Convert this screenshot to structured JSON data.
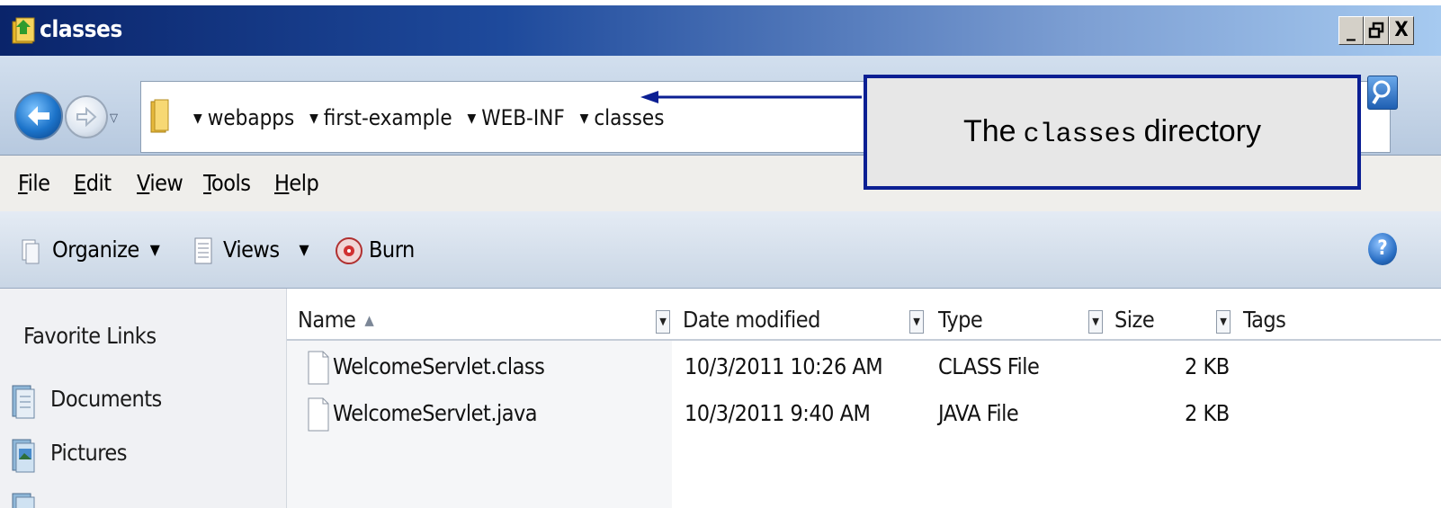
{
  "window": {
    "title": "classes",
    "controls": {
      "minimize": "_",
      "restore": "🗗",
      "close": "X"
    }
  },
  "address_bar": {
    "breadcrumbs": [
      "webapps",
      "first-example",
      "WEB-INF",
      "classes"
    ]
  },
  "menu": {
    "items": [
      {
        "label": "File",
        "mnemonic": "F",
        "rest": "ile"
      },
      {
        "label": "Edit",
        "mnemonic": "E",
        "rest": "dit"
      },
      {
        "label": "View",
        "mnemonic": "V",
        "rest": "iew"
      },
      {
        "label": "Tools",
        "mnemonic": "T",
        "rest": "ools"
      },
      {
        "label": "Help",
        "mnemonic": "H",
        "rest": "elp"
      }
    ]
  },
  "command_bar": {
    "organize": "Organize",
    "views": "Views",
    "burn": "Burn",
    "caret": "▼",
    "help": "?"
  },
  "nav_pane": {
    "title": "Favorite Links",
    "links": [
      "Documents",
      "Pictures"
    ]
  },
  "file_list": {
    "columns": [
      "Name",
      "Date modified",
      "Type",
      "Size",
      "Tags"
    ],
    "sort_indicator": "▲",
    "rows": [
      {
        "name": "WelcomeServlet.class",
        "date": "10/3/2011 10:26 AM",
        "type": "CLASS File",
        "size": "2 KB"
      },
      {
        "name": "WelcomeServlet.java",
        "date": "10/3/2011 9:40 AM",
        "type": "JAVA File",
        "size": "2 KB"
      }
    ]
  },
  "callout": {
    "prefix": "The",
    "code": "classes",
    "suffix": "directory"
  },
  "colors": {
    "callout_border": "#0b1f93",
    "arrow": "#0b1f93",
    "titlebar": "#0a246a"
  }
}
